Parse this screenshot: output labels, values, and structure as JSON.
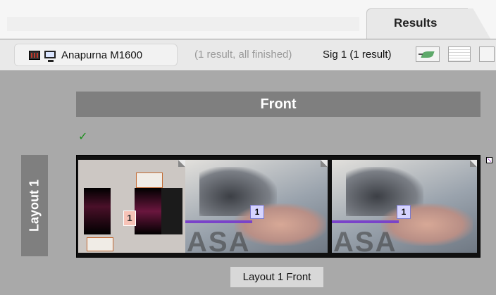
{
  "tab": {
    "label": "Results"
  },
  "toolbar": {
    "device_name": "Anapurna M1600",
    "status": "(1 result, all finished)",
    "signature": "Sig 1 (1 result)"
  },
  "content": {
    "side": "Front",
    "layout": "Layout 1",
    "caption": "Layout 1 Front",
    "thumb_labels": [
      "1",
      "1",
      "1"
    ]
  }
}
